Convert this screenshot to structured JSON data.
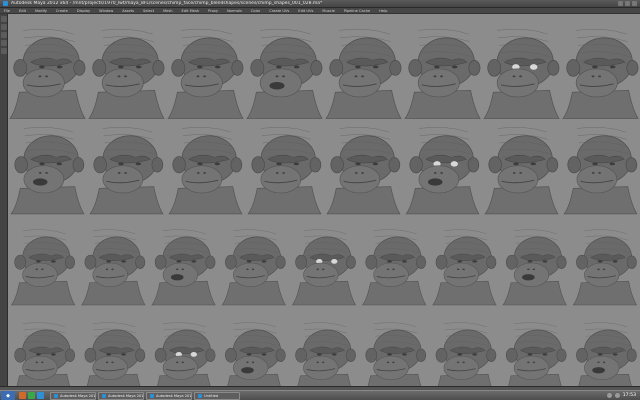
{
  "window": {
    "title": "Autodesk Maya 2012 x64 - /mnt/projects/1970_lwt/maya_8FL/scenes/chimp_face/chimp_blendshapes/scenes/chimp_shapes_001_028.ma*"
  },
  "menubar": {
    "items": [
      "File",
      "Edit",
      "Modify",
      "Create",
      "Display",
      "Window",
      "Assets",
      "Select",
      "Mesh",
      "Edit Mesh",
      "Proxy",
      "Normals",
      "Color",
      "Create UVs",
      "Edit UVs",
      "Muscle",
      "Pipeline Cache",
      "Help"
    ]
  },
  "viewport": {
    "background": "#8c8c8c",
    "rows": [
      {
        "count": 8,
        "y": 0.16,
        "size": 0.95
      },
      {
        "count": 8,
        "y": 0.42,
        "size": 0.92
      },
      {
        "count": 9,
        "y": 0.68,
        "size": 0.9
      },
      {
        "count": 9,
        "y": 0.93,
        "size": 0.9
      }
    ]
  },
  "taskbar": {
    "start_label": "◆",
    "tasks": [
      "Autodesk Maya 201...",
      "Autodesk Maya 201...",
      "Autodesk Maya 201...",
      "Untitled"
    ],
    "clock": "17:53"
  }
}
